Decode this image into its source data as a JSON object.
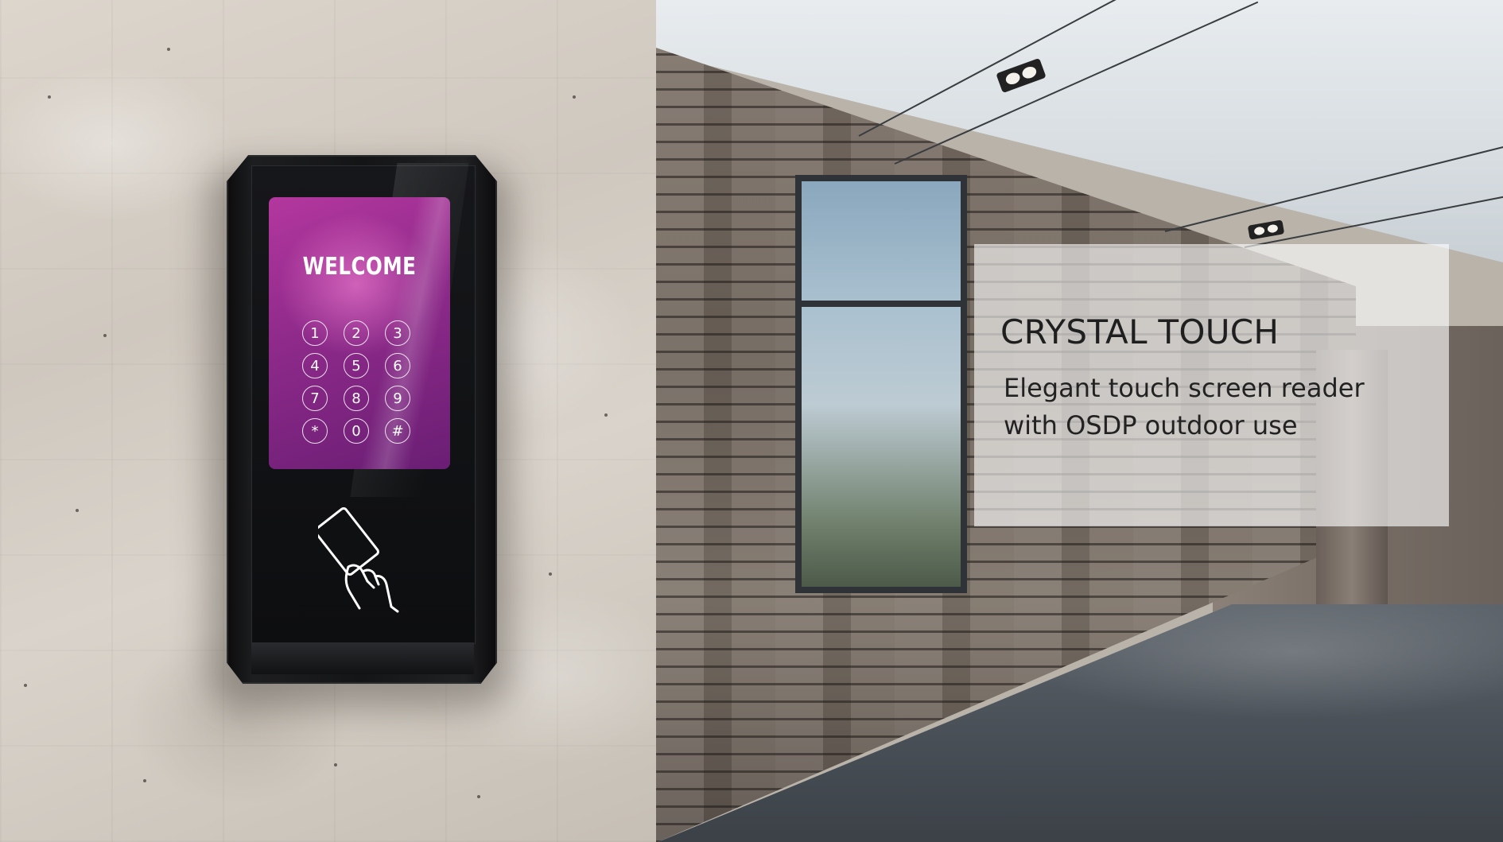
{
  "scene": {
    "description_left": "concrete-wall",
    "description_right": "brick-lobby"
  },
  "device": {
    "screen_title": "WELCOME",
    "keys": [
      "1",
      "2",
      "3",
      "4",
      "5",
      "6",
      "7",
      "8",
      "9",
      "*",
      "0",
      "#"
    ],
    "card_icon": "hand-holding-card-icon",
    "screen_color": "#9b2f8e"
  },
  "caption": {
    "title": "CRYSTAL TOUCH",
    "line1": "Elegant touch screen reader",
    "line2": "with OSDP outdoor use"
  }
}
